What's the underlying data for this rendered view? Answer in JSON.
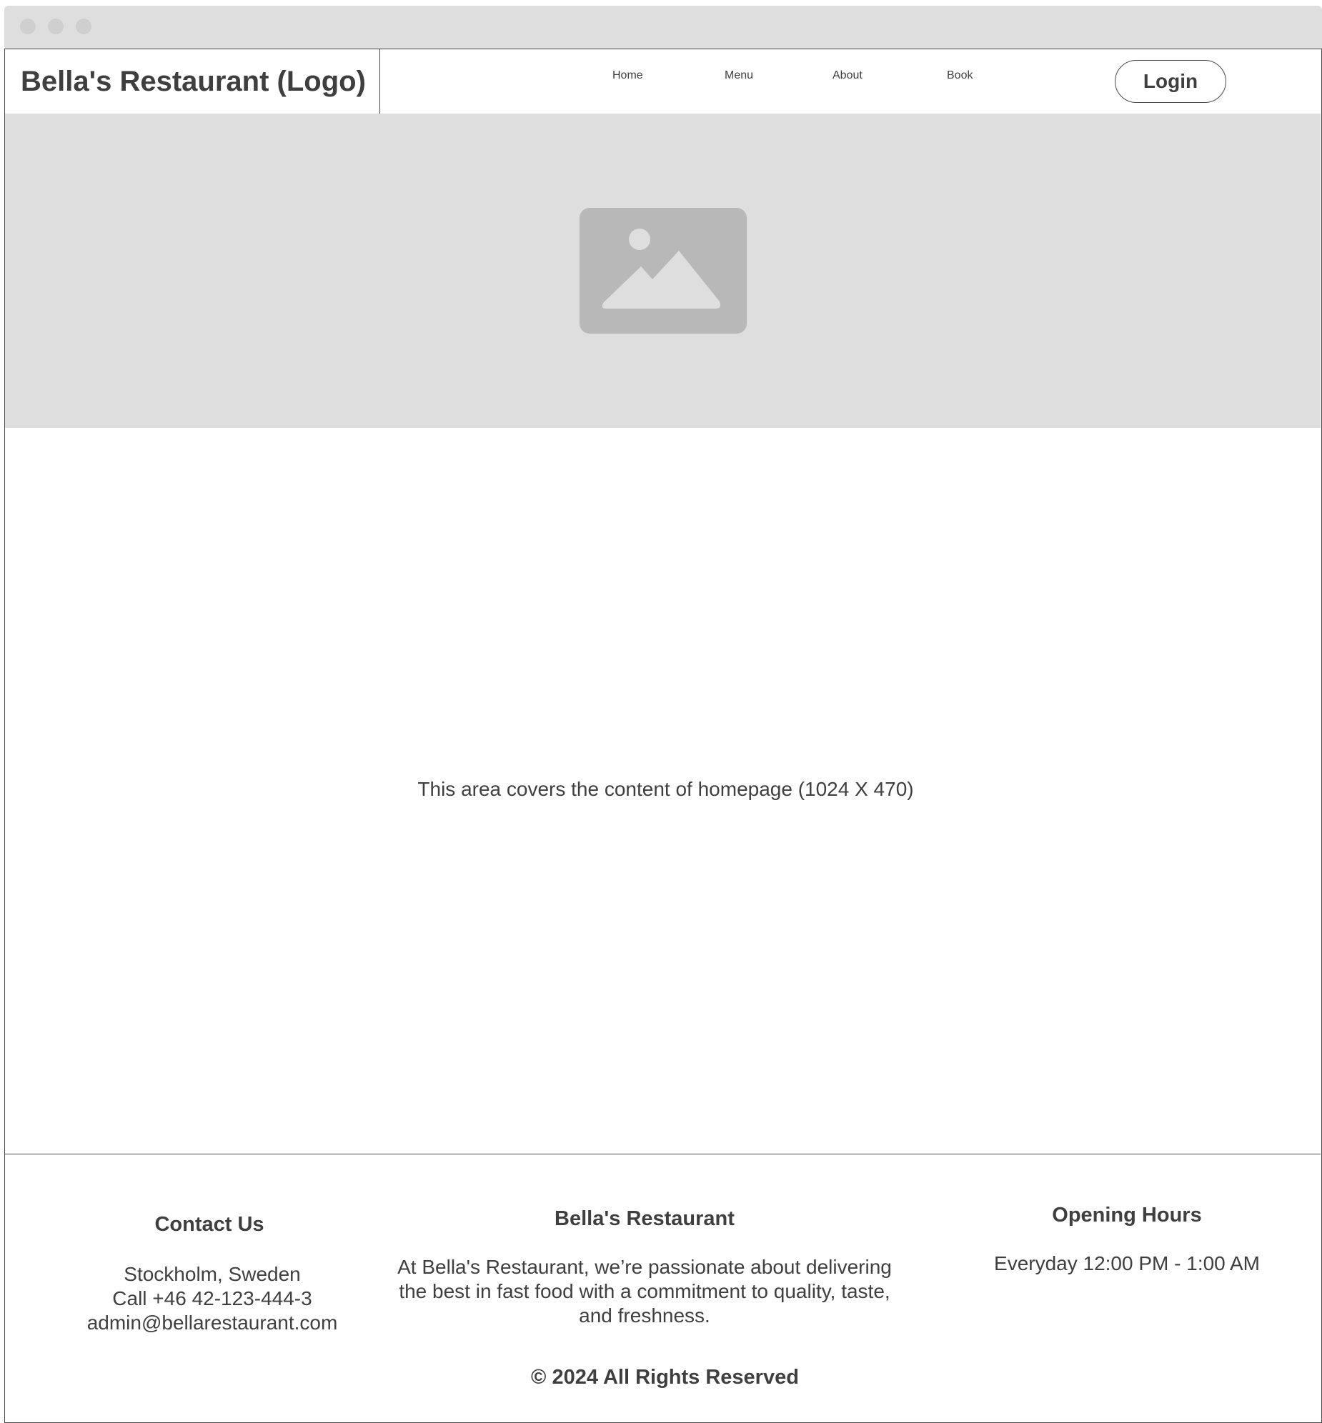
{
  "header": {
    "logo_text": "Bella's Restaurant (Logo)",
    "nav": {
      "home": "Home",
      "menu": "Menu",
      "about": "About",
      "book": "Book"
    },
    "login_label": "Login"
  },
  "hero": {
    "image_icon": "image-placeholder-icon"
  },
  "main": {
    "content_note": "This area covers the content of homepage (1024 X 470)"
  },
  "footer": {
    "contact": {
      "title": "Contact Us",
      "location": "Stockholm, Sweden",
      "phone": "Call +46 42-123-444-3",
      "email": "admin@bellarestaurant.com"
    },
    "about": {
      "title": "Bella's Restaurant",
      "description": "At Bella's Restaurant, we’re passionate about delivering the best in fast food with a commitment to quality, taste, and freshness."
    },
    "hours": {
      "title": "Opening Hours",
      "schedule": "Everyday 12:00 PM - 1:00 AM"
    },
    "copyright": "© 2024 All Rights Reserved"
  },
  "colors": {
    "chrome": "#dedede",
    "placeholder_icon": "#b8b8b8",
    "text": "#3f3f3f",
    "border": "#4a4a4a"
  }
}
